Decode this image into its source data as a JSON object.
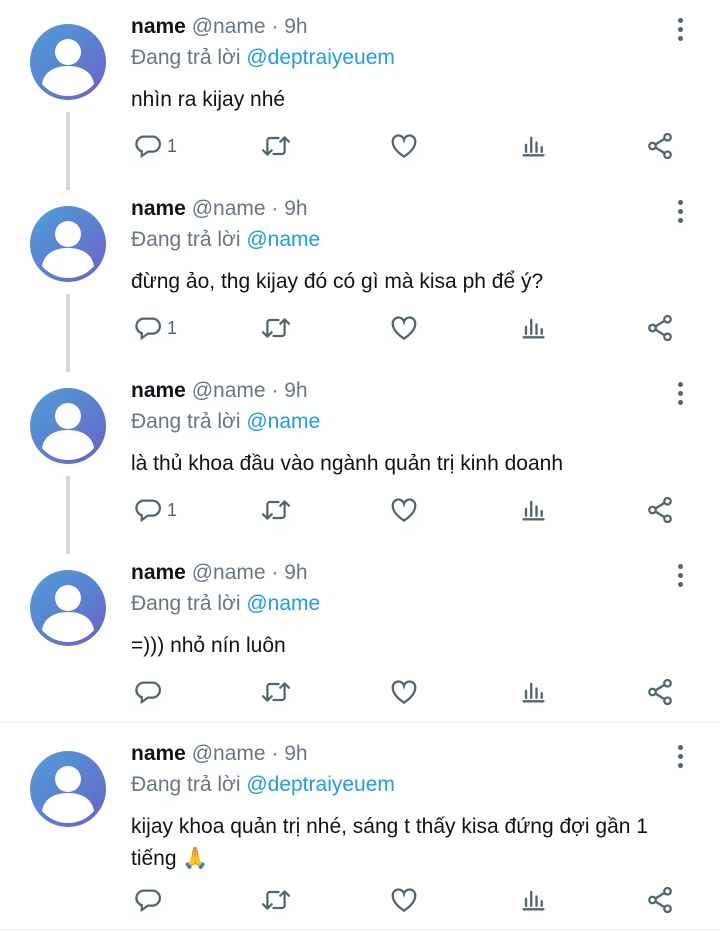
{
  "tweets": [
    {
      "name": "name",
      "handle": "@name",
      "separator": "·",
      "time": "9h",
      "reply_prefix": "Đang trả lời",
      "reply_to": "@deptraiyeuem",
      "text": "nhìn ra kijay nhé",
      "reply_count": "1",
      "thread_line": true
    },
    {
      "name": "name",
      "handle": "@name",
      "separator": "·",
      "time": "9h",
      "reply_prefix": "Đang trả lời",
      "reply_to": "@name",
      "text": "đừng ảo, thg kijay đó có gì mà kisa ph để ý?",
      "reply_count": "1",
      "thread_line": true
    },
    {
      "name": "name",
      "handle": "@name",
      "separator": "·",
      "time": "9h",
      "reply_prefix": "Đang trả lời",
      "reply_to": "@name",
      "text": "là thủ khoa đầu vào ngành quản trị kinh doanh",
      "reply_count": "1",
      "thread_line": true
    },
    {
      "name": "name",
      "handle": "@name",
      "separator": "·",
      "time": "9h",
      "reply_prefix": "Đang trả lời",
      "reply_to": "@name",
      "text": "=))) nhỏ nín luôn",
      "reply_count": "",
      "thread_line": false
    },
    {
      "name": "name",
      "handle": "@name",
      "separator": "·",
      "time": "9h",
      "reply_prefix": "Đang trả lời",
      "reply_to": "@deptraiyeuem",
      "text": "kijay khoa quản trị nhé, sáng t thấy kisa đứng đợi gần 1 tiếng 🙏",
      "reply_count": "",
      "thread_line": false
    }
  ],
  "icons": {
    "reply": "reply-icon",
    "retweet": "retweet-icon",
    "like": "heart-icon",
    "views": "views-icon",
    "share": "share-icon",
    "more": "more-vertical-icon"
  },
  "colors": {
    "text": "#0f1419",
    "secondary": "#687684",
    "mention": "#1d9bf0",
    "thread_line": "#cfd9de",
    "divider": "#e6ecf0"
  }
}
